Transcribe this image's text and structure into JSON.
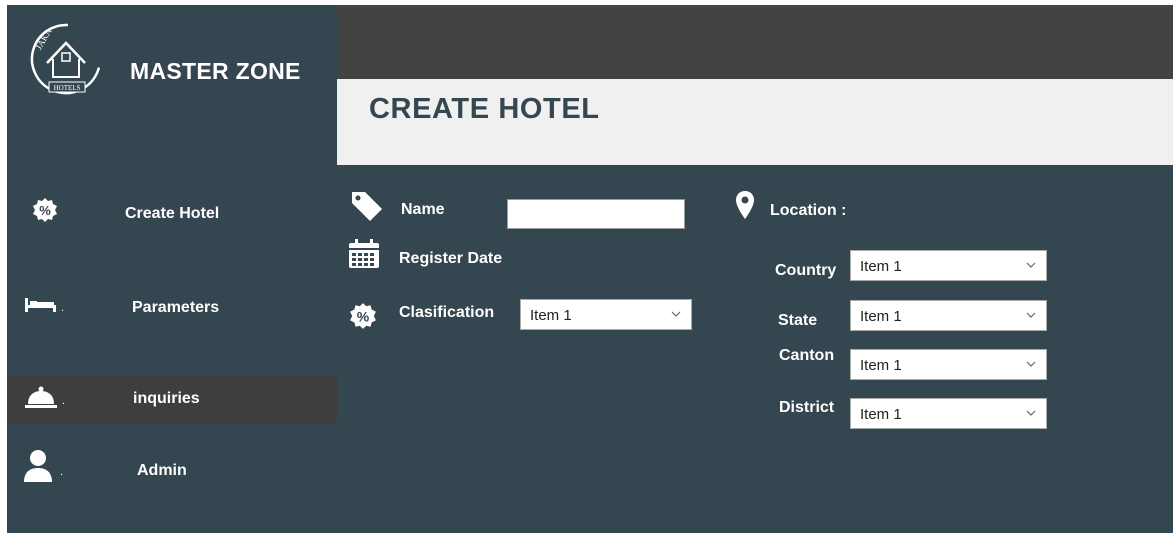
{
  "app": {
    "brand": "MASTER ZONE",
    "logo_lettering": [
      "JAKA",
      "HOTELS"
    ]
  },
  "page": {
    "title": "CREATE HOTEL"
  },
  "sidebar": {
    "items": [
      {
        "label": "Create Hotel",
        "icon": "percent-badge-icon",
        "active": false
      },
      {
        "label": "Parameters",
        "icon": "bed-icon",
        "active": false
      },
      {
        "label": "inquiries",
        "icon": "service-bell-icon",
        "active": true
      },
      {
        "label": "Admin",
        "icon": "user-icon",
        "active": false
      }
    ]
  },
  "form": {
    "name": {
      "label": "Name",
      "value": "",
      "icon": "tag-icon"
    },
    "register_date": {
      "label": "Register Date",
      "icon": "calendar-icon"
    },
    "clasification": {
      "label": "Clasification",
      "selected": "Item 1",
      "icon": "percent-badge-icon"
    }
  },
  "location": {
    "label": "Location :",
    "icon": "map-pin-icon",
    "country": {
      "label": "Country",
      "selected": "Item 1"
    },
    "state": {
      "label": "State",
      "selected": "Item 1"
    },
    "canton": {
      "label": "Canton",
      "selected": "Item 1"
    },
    "district": {
      "label": "District",
      "selected": "Item 1"
    }
  },
  "colors": {
    "background": "#34464f",
    "topbar": "#434343",
    "header_band": "#f0f0f0",
    "active_nav": "#3e3e3e",
    "title_text": "#34464f"
  }
}
